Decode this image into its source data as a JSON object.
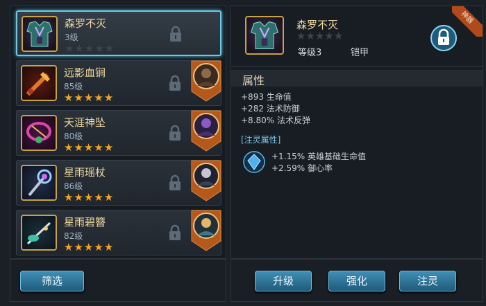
{
  "items": [
    {
      "name": "森罗不灭",
      "level": "3级",
      "stars_on": 0,
      "stars_total": 5,
      "has_badge": false
    },
    {
      "name": "远影血锏",
      "level": "85级",
      "stars_on": 5,
      "stars_total": 5,
      "has_badge": true
    },
    {
      "name": "天涯神坠",
      "level": "80级",
      "stars_on": 5,
      "stars_total": 5,
      "has_badge": true
    },
    {
      "name": "星雨瑶杖",
      "level": "86级",
      "stars_on": 5,
      "stars_total": 5,
      "has_badge": true
    },
    {
      "name": "星雨碧簪",
      "level": "82级",
      "stars_on": 5,
      "stars_total": 5,
      "has_badge": true
    }
  ],
  "filter_label": "筛选",
  "detail": {
    "name": "森罗不灭",
    "stars_on": 0,
    "stars_total": 5,
    "level_text": "等级3",
    "type": "铠甲",
    "corner_tag": "神器",
    "attr_title": "属性",
    "attrs": [
      "+893 生命值",
      "+282 法术防御",
      "+8.80% 法术反弹"
    ],
    "spirit_title": "[注灵属性]",
    "spirit_attrs": [
      "+1.15% 英雄基础生命值",
      "+2.59% 御心率"
    ]
  },
  "buttons": {
    "upgrade": "升级",
    "enhance": "强化",
    "infuse": "注灵"
  },
  "colors": {
    "accent": "#6fc9e6",
    "star": "#f3a526",
    "name_gold": "#f0d9a0",
    "button": "#2f7aa1"
  }
}
